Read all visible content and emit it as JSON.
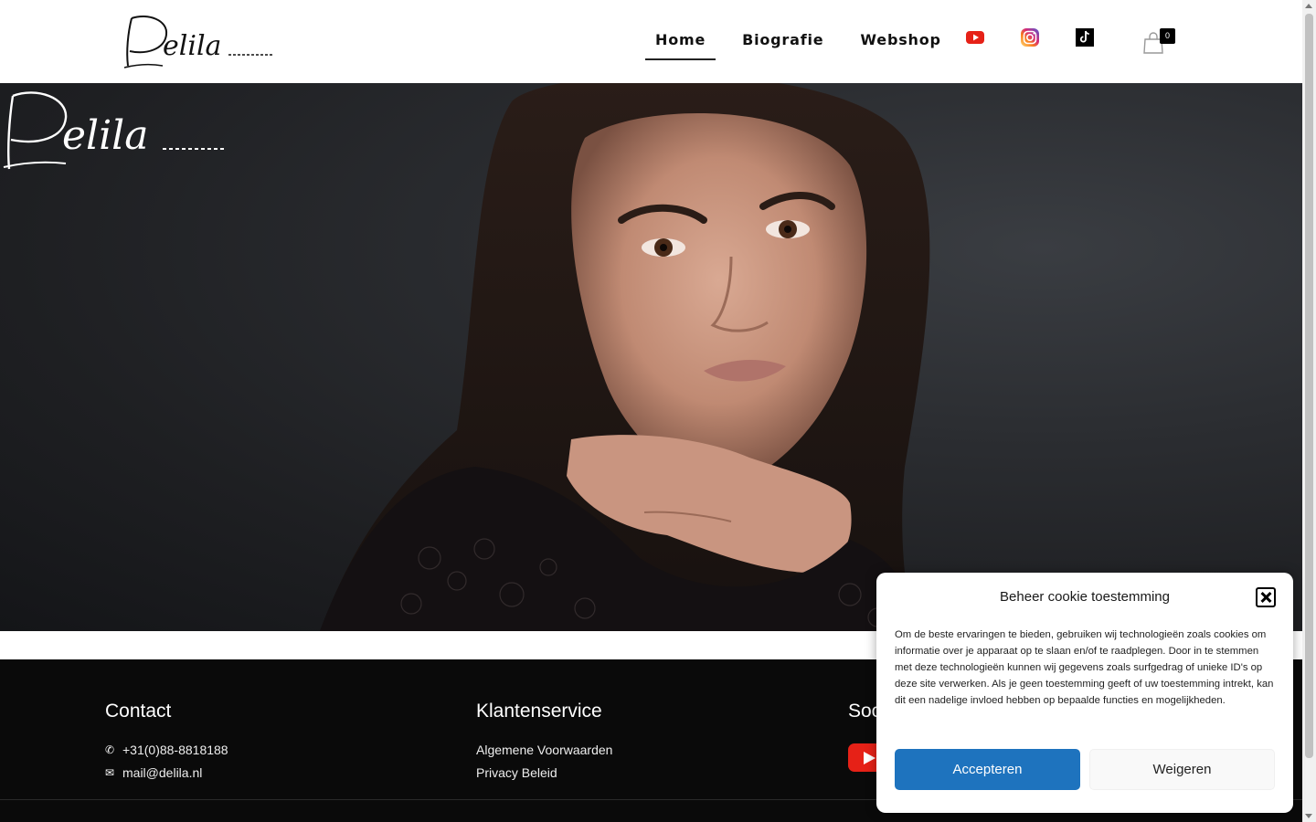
{
  "header": {
    "logo_text": "Delila",
    "nav": [
      {
        "label": "Home",
        "active": true
      },
      {
        "label": "Biografie",
        "active": false
      },
      {
        "label": "Webshop",
        "active": false
      }
    ],
    "social_icons": [
      "youtube-icon",
      "instagram-icon",
      "tiktok-icon"
    ],
    "cart_count": "0"
  },
  "hero": {
    "signature_text": "Delila"
  },
  "footer": {
    "contact": {
      "heading": "Contact",
      "phone": "+31(0)88-8818188",
      "email": "mail@delila.nl"
    },
    "service": {
      "heading": "Klantenservice",
      "links": [
        "Algemene Voorwaarden",
        "Privacy Beleid"
      ]
    },
    "social": {
      "heading": "Soc"
    }
  },
  "cookie": {
    "title": "Beheer cookie toestemming",
    "text": "Om de beste ervaringen te bieden, gebruiken wij technologieën zoals cookies om informatie over je apparaat op te slaan en/of te raadplegen. Door in te stemmen met deze technologieën kunnen wij gegevens zoals surfgedrag of unieke ID's op deze site verwerken. Als je geen toestemming geeft of uw toestemming intrekt, kan dit een nadelige invloed hebben op bepaalde functies en mogelijkheden.",
    "accept": "Accepteren",
    "deny": "Weigeren"
  },
  "colors": {
    "accent": "#1e73be",
    "footer_bg": "#0a0a0a",
    "youtube": "#e62117"
  }
}
